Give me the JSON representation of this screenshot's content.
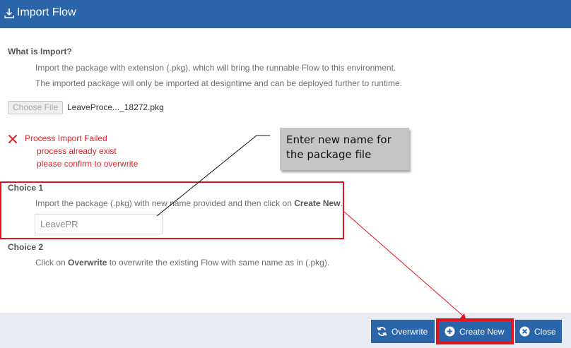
{
  "header": {
    "title": "Import Flow",
    "icon": "download-icon"
  },
  "what_is": {
    "heading": "What is Import?",
    "line1": "Import the package with extension (.pkg), which will bring the runnable Flow to this environment.",
    "line2": "The imported package will only be imported at designtime and can be deployed further to runtime."
  },
  "file": {
    "choose_label": "Choose File",
    "filename": "LeaveProce..._18272.pkg"
  },
  "error": {
    "title": "Process Import Failed",
    "line1": "process already exist",
    "line2": "please confirm to overwrite"
  },
  "choice1": {
    "heading": "Choice 1",
    "text_pre": "Import the package (.pkg) with new name provided and then click on ",
    "text_bold": "Create New",
    "text_post": ".",
    "input_value": "LeavePR"
  },
  "choice2": {
    "heading": "Choice 2",
    "text_pre": "Click on ",
    "text_bold": "Overwrite",
    "text_post": " to overwrite the existing Flow with same name as in (.pkg)."
  },
  "callout": {
    "line1": "Enter new name for",
    "line2": "the package file"
  },
  "buttons": {
    "overwrite": "Overwrite",
    "create_new": "Create New",
    "close": "Close"
  },
  "colors": {
    "primary": "#2a64a9",
    "error": "#d9252b",
    "annotation": "#e0151f"
  }
}
